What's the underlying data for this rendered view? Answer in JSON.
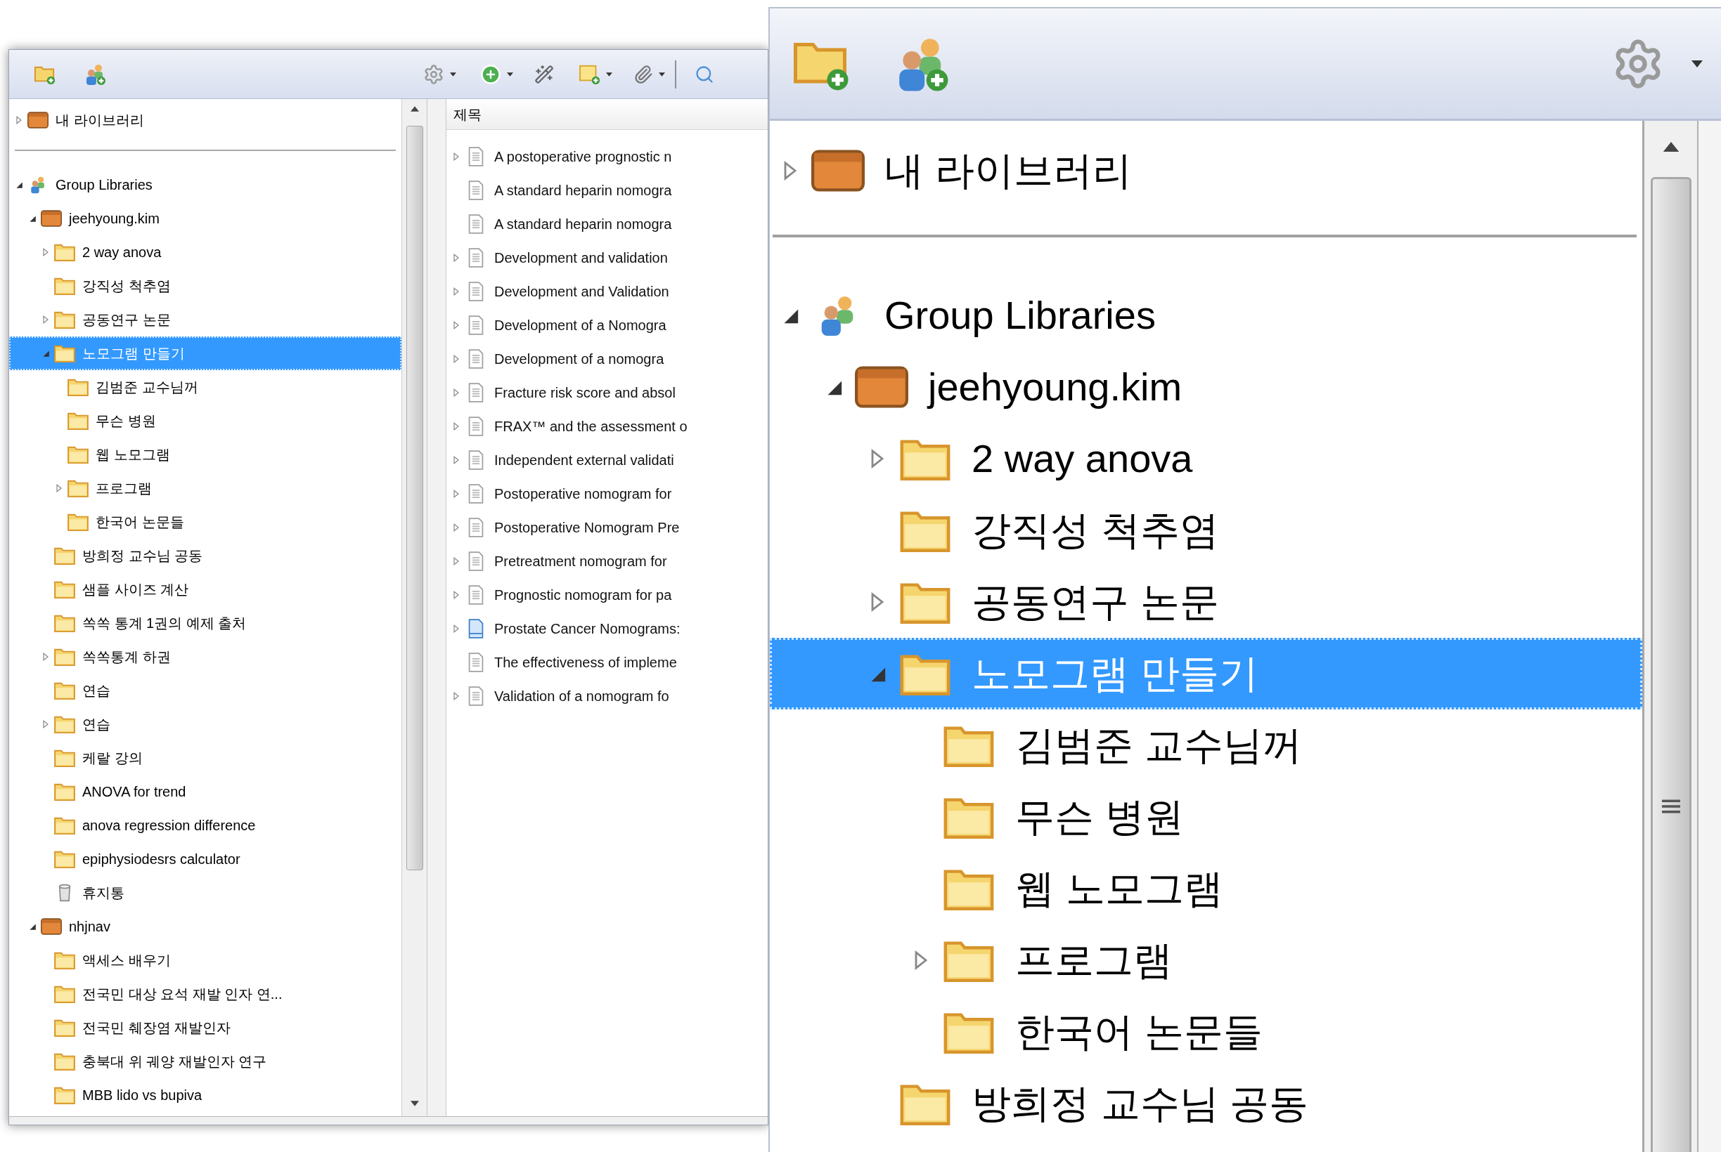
{
  "main_window": {
    "collections": [
      {
        "label": "내 라이브러리",
        "kind": "library",
        "expanded": false,
        "selected": false
      },
      {
        "label": "Group Libraries",
        "kind": "group",
        "expanded": true,
        "selected": false,
        "children": [
          {
            "label": "jeehyoung.kim",
            "kind": "library",
            "expanded": true,
            "selected": false,
            "children": [
              {
                "label": "2 way anova",
                "kind": "folder",
                "expanded": false,
                "selected": false
              },
              {
                "label": "강직성 척추염",
                "kind": "folder",
                "selected": false
              },
              {
                "label": "공동연구 논문",
                "kind": "folder",
                "expanded": false,
                "selected": false
              },
              {
                "label": "노모그램 만들기",
                "kind": "folder",
                "expanded": true,
                "selected": true,
                "children": [
                  {
                    "label": "김범준 교수님꺼",
                    "kind": "folder",
                    "selected": false
                  },
                  {
                    "label": "무슨 병원",
                    "kind": "folder",
                    "selected": false
                  },
                  {
                    "label": "웹 노모그램",
                    "kind": "folder",
                    "selected": false
                  },
                  {
                    "label": "프로그램",
                    "kind": "folder",
                    "expanded": false,
                    "selected": false
                  },
                  {
                    "label": "한국어 논문들",
                    "kind": "folder",
                    "selected": false
                  }
                ]
              },
              {
                "label": "방희정 교수님 공동",
                "kind": "folder",
                "selected": false
              },
              {
                "label": "샘플 사이즈 계산",
                "kind": "folder",
                "selected": false
              },
              {
                "label": "쏙쏙 통계 1권의 예제 출처",
                "kind": "folder",
                "selected": false
              },
              {
                "label": "쏙쏙통계 하권",
                "kind": "folder",
                "expanded": false,
                "selected": false
              },
              {
                "label": "연습",
                "kind": "folder",
                "selected": false
              },
              {
                "label": "연습",
                "kind": "folder",
                "expanded": false,
                "selected": false
              },
              {
                "label": "케랄 강의",
                "kind": "folder",
                "selected": false
              },
              {
                "label": "ANOVA for trend",
                "kind": "folder",
                "selected": false
              },
              {
                "label": "anova regression difference",
                "kind": "folder",
                "selected": false
              },
              {
                "label": "epiphysiodesrs calculator",
                "kind": "folder",
                "selected": false
              },
              {
                "label": "휴지통",
                "kind": "trash",
                "selected": false
              }
            ]
          },
          {
            "label": "nhjnav",
            "kind": "library",
            "expanded": true,
            "selected": false,
            "children": [
              {
                "label": "액세스 배우기",
                "kind": "folder",
                "selected": false
              },
              {
                "label": "전국민 대상 요석 재발 인자 연...",
                "kind": "folder",
                "selected": false
              },
              {
                "label": "전국민 췌장염 재발인자",
                "kind": "folder",
                "selected": false
              },
              {
                "label": "충북대 위 궤양 재발인자 연구",
                "kind": "folder",
                "selected": false
              },
              {
                "label": "MBB lido vs bupiva",
                "kind": "folder",
                "selected": false
              }
            ]
          }
        ]
      }
    ],
    "items": {
      "column": "제목",
      "rows": [
        {
          "title": "A postoperative prognostic n",
          "kind": "document",
          "has_children": true
        },
        {
          "title": "A standard heparin nomogra",
          "kind": "document",
          "has_children": false
        },
        {
          "title": "A standard heparin nomogra",
          "kind": "document",
          "has_children": false
        },
        {
          "title": "Development and validation",
          "kind": "document",
          "has_children": true
        },
        {
          "title": "Development and Validation",
          "kind": "document",
          "has_children": true
        },
        {
          "title": "Development of a Nomogra",
          "kind": "document",
          "has_children": true
        },
        {
          "title": "Development of a nomogra",
          "kind": "document",
          "has_children": true
        },
        {
          "title": "Fracture risk score and absol",
          "kind": "document",
          "has_children": true
        },
        {
          "title": "FRAX™ and the assessment o",
          "kind": "document",
          "has_children": true
        },
        {
          "title": "Independent external validati",
          "kind": "document",
          "has_children": true
        },
        {
          "title": "Postoperative nomogram for",
          "kind": "document",
          "has_children": true
        },
        {
          "title": "Postoperative Nomogram Pre",
          "kind": "document",
          "has_children": true
        },
        {
          "title": "Pretreatment nomogram for",
          "kind": "document",
          "has_children": true
        },
        {
          "title": "Prognostic nomogram for pa",
          "kind": "document",
          "has_children": true
        },
        {
          "title": "Prostate Cancer Nomograms:",
          "kind": "webpage",
          "has_children": true
        },
        {
          "title": "The effectiveness of impleme",
          "kind": "document",
          "has_children": false
        },
        {
          "title": "Validation of a nomogram fo",
          "kind": "document",
          "has_children": true
        }
      ]
    }
  },
  "zoom_inset": {
    "collections": [
      {
        "label": "내 라이브러리",
        "kind": "library",
        "expanded": false,
        "selected": false
      },
      {
        "label": "Group Libraries",
        "kind": "group",
        "expanded": true,
        "selected": false,
        "children": [
          {
            "label": "jeehyoung.kim",
            "kind": "library",
            "expanded": true,
            "selected": false,
            "children": [
              {
                "label": "2 way anova",
                "kind": "folder",
                "expanded": false,
                "selected": false
              },
              {
                "label": "강직성 척추염",
                "kind": "folder",
                "selected": false
              },
              {
                "label": "공동연구 논문",
                "kind": "folder",
                "expanded": false,
                "selected": false
              },
              {
                "label": "노모그램 만들기",
                "kind": "folder",
                "expanded": true,
                "selected": true,
                "children": [
                  {
                    "label": "김범준 교수님꺼",
                    "kind": "folder",
                    "selected": false
                  },
                  {
                    "label": "무슨 병원",
                    "kind": "folder",
                    "selected": false
                  },
                  {
                    "label": "웹 노모그램",
                    "kind": "folder",
                    "selected": false
                  },
                  {
                    "label": "프로그램",
                    "kind": "folder",
                    "expanded": false,
                    "selected": false
                  },
                  {
                    "label": "한국어 논문들",
                    "kind": "folder",
                    "selected": false
                  }
                ]
              },
              {
                "label": "방희정 교수님 공동",
                "kind": "folder",
                "selected": false
              }
            ]
          }
        ]
      }
    ]
  }
}
